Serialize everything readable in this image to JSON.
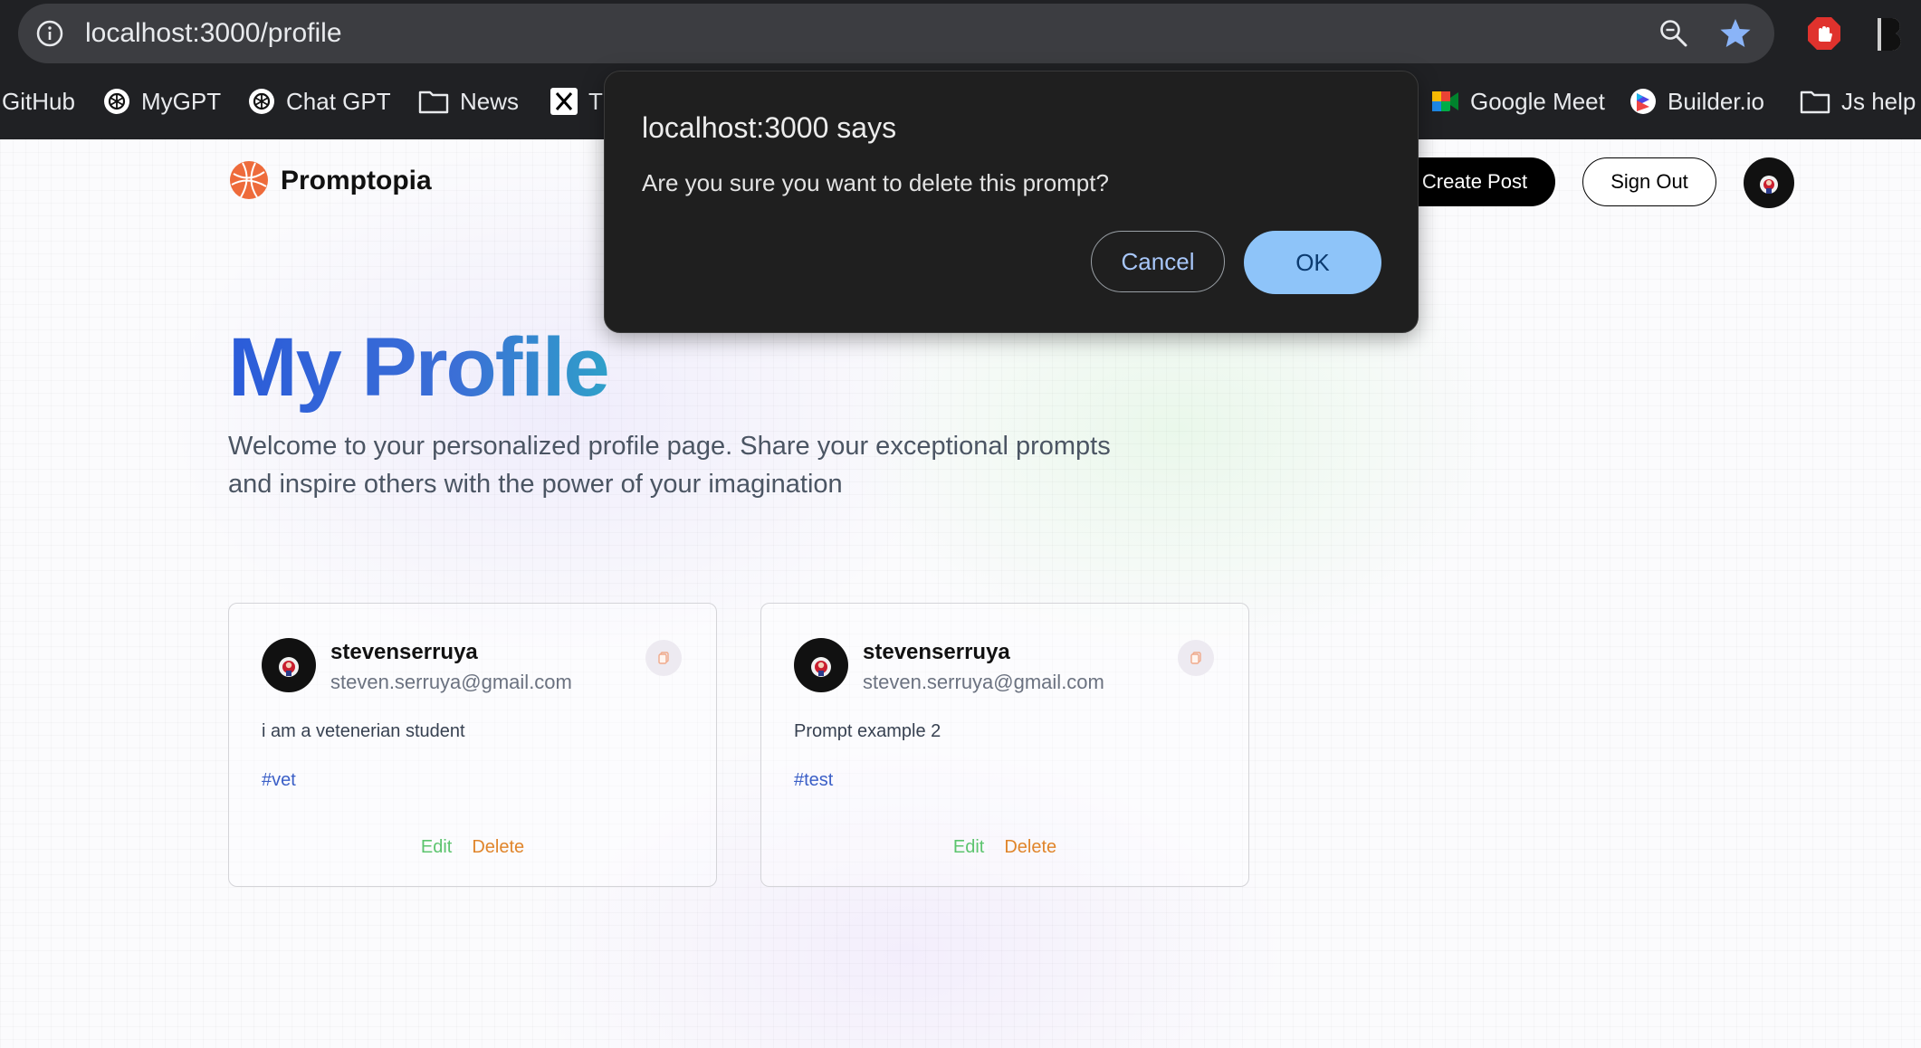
{
  "browser": {
    "url": "localhost:3000/profile",
    "bookmarks": [
      {
        "label": "GitHub",
        "icon": "none"
      },
      {
        "label": "MyGPT",
        "icon": "openai-icon"
      },
      {
        "label": "Chat GPT",
        "icon": "openai-icon"
      },
      {
        "label": "News",
        "icon": "folder-icon"
      },
      {
        "label": "T",
        "icon": "x-icon"
      },
      {
        "label": "Google Meet",
        "icon": "google-meet-icon"
      },
      {
        "label": "Builder.io",
        "icon": "builder-icon"
      },
      {
        "label": "Js help",
        "icon": "folder-icon"
      }
    ]
  },
  "nav": {
    "brand": "Promptopia",
    "create_post": "Create Post",
    "sign_out": "Sign Out"
  },
  "profile": {
    "title": "My Profile",
    "description": "Welcome to your personalized profile page. Share your exceptional prompts and inspire others with the power of your imagination"
  },
  "cards": [
    {
      "username": "stevenserruya",
      "email": "steven.serruya@gmail.com",
      "prompt": "i am a vetenerian student",
      "tag": "#vet",
      "edit": "Edit",
      "delete": "Delete"
    },
    {
      "username": "stevenserruya",
      "email": "steven.serruya@gmail.com",
      "prompt": "Prompt example 2",
      "tag": "#test",
      "edit": "Edit",
      "delete": "Delete"
    }
  ],
  "dialog": {
    "title": "localhost:3000 says",
    "message": "Are you sure you want to delete this prompt?",
    "cancel": "Cancel",
    "ok": "OK"
  },
  "colors": {
    "chrome_bg": "#202124",
    "title_gradient_start": "#2b5cd9",
    "title_gradient_end": "#2fa0c9",
    "edit": "#5cc46e",
    "delete": "#e0852b",
    "tag": "#3b5fc7",
    "dialog_ok": "#8ec4f9"
  }
}
